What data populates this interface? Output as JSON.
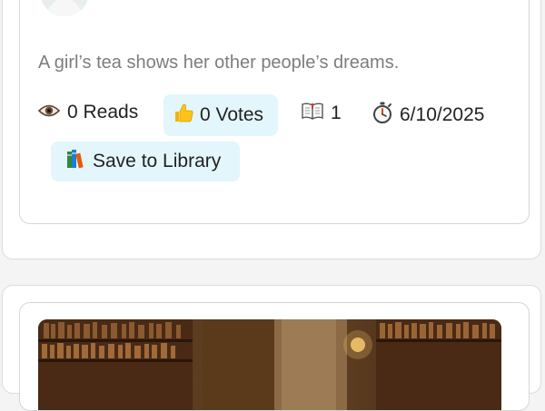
{
  "story": {
    "description": "A girl’s tea shows her other people’s dreams.",
    "reads_label": "0 Reads",
    "votes_label": "0 Votes",
    "parts_count": "1",
    "date": "6/10/2025",
    "save_label": "Save to Library"
  },
  "icons": {
    "reads": "eye-icon",
    "votes": "thumbs-up-icon",
    "parts": "open-book-icon",
    "date": "stopwatch-icon",
    "save": "books-icon"
  },
  "colors": {
    "pill_background": "#e3f6fb",
    "description_text": "#7d7d7d",
    "card_border": "#d6d6d6"
  }
}
